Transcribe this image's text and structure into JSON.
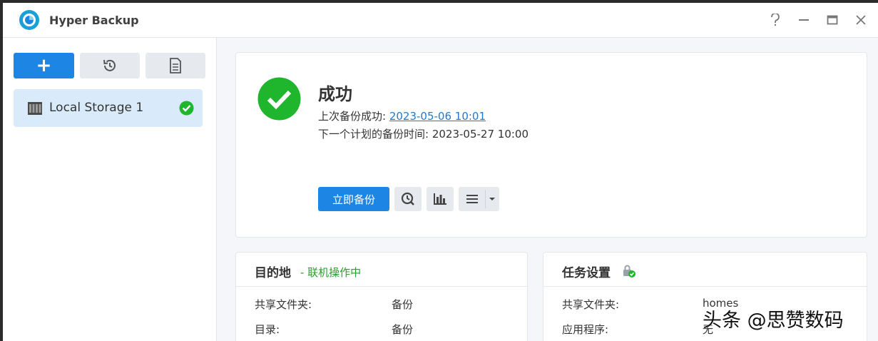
{
  "window": {
    "title": "Hyper Backup",
    "controls": [
      "help-icon",
      "minimize-icon",
      "maximize-icon",
      "close-icon"
    ]
  },
  "toolbar": {
    "add": "+",
    "icons": [
      "plus-icon",
      "history-restore-icon",
      "log-document-icon"
    ]
  },
  "tasks": [
    {
      "label": "Local Storage 1",
      "status_icon": "success-check-icon"
    }
  ],
  "status": {
    "title": "成功",
    "last_prefix": "上次备份成功:",
    "last_time": "2023-05-06 10:01",
    "next_prefix": "下一个计划的备份时间:",
    "next_time": "2023-05-27 10:00",
    "backup_now": "立即备份",
    "actions": [
      "version-clock-icon",
      "statistics-chart-icon",
      "menu-list-icon",
      "dropdown-caret-icon"
    ]
  },
  "destination": {
    "title": "目的地",
    "status": "- 联机操作中",
    "rows": [
      {
        "key": "共享文件夹:",
        "value": "备份"
      },
      {
        "key": "目录:",
        "value": "备份"
      }
    ]
  },
  "task_settings": {
    "title": "任务设置",
    "rows": [
      {
        "key": "共享文件夹:",
        "value": "homes"
      },
      {
        "key": "应用程序:",
        "value": "无"
      }
    ]
  },
  "watermark": "头条 @思赞数码",
  "colors": {
    "accent": "#1d86e5",
    "success": "#1fb52c",
    "link": "#1d7bd1",
    "online": "#27a02c"
  }
}
